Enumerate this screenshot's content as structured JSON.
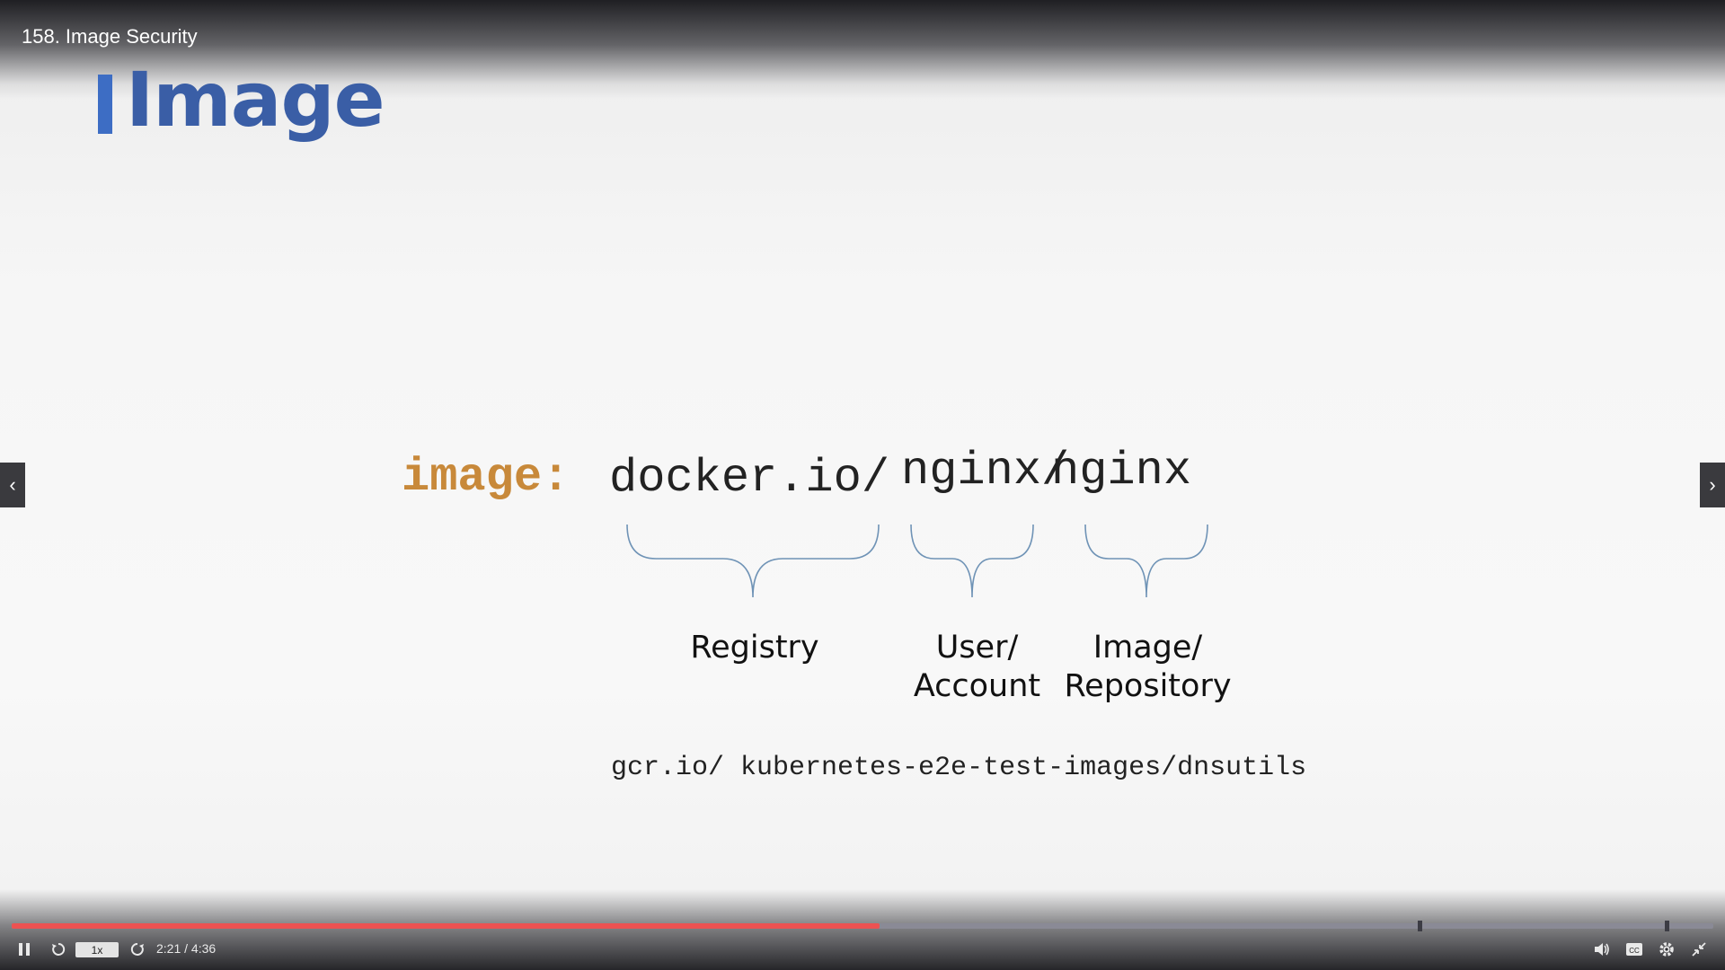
{
  "player": {
    "lecture_title": "158. Image Security",
    "progress": {
      "current_seconds": 141,
      "total_seconds": 276,
      "fraction": 0.51
    },
    "speed": "1x",
    "time_display": "2:21 / 4:36",
    "colors": {
      "progress_played": "#ec5252",
      "progress_track": "#8a8a96"
    },
    "icons": {
      "play_pause": "pause-icon",
      "rewind": "rewind-icon",
      "forward": "forward-icon",
      "volume": "volume-icon",
      "captions": "captions-icon",
      "settings": "gear-icon",
      "fullscreen": "exit-fullscreen-icon",
      "prev": "chevron-left-icon",
      "next": "chevron-right-icon"
    }
  },
  "slide": {
    "title": "Image",
    "image_key": "image:",
    "segments": {
      "registry": "docker.io/",
      "user": "nginx/",
      "image": "nginx"
    },
    "labels": {
      "registry": "Registry",
      "user": "User/\nAccount",
      "image": "Image/\nRepository"
    },
    "example": "gcr.io/ kubernetes-e2e-test-images/dnsutils",
    "colors": {
      "title": "#3a5ea6",
      "accent_bar": "#3d6dc4",
      "key": "#c8893a",
      "brace": "#6f93b6"
    }
  }
}
